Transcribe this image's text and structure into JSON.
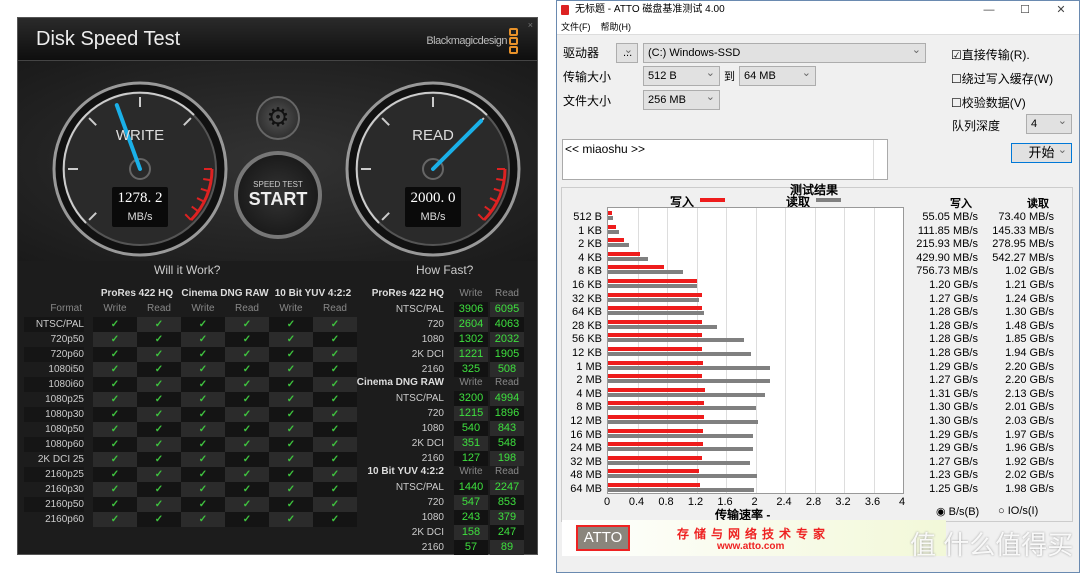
{
  "bm": {
    "title": "Disk Speed Test",
    "brand": "Blackmagicdesign",
    "close": "×",
    "write_label": "WRITE",
    "read_label": "READ",
    "write_value": "1278. 2",
    "read_value": "2000. 0",
    "unit": "MB/s",
    "write_mbps": 1278.2,
    "read_mbps": 2000.0,
    "needle_color": "#1ab0e8",
    "accent": "#e8922a",
    "start_small": "SPEED TEST",
    "start_big": "START",
    "will_title": "Will it Work?",
    "how_title": "How Fast?",
    "groups": [
      "ProRes 422 HQ",
      "Cinema DNG RAW",
      "10 Bit YUV 4:2:2"
    ],
    "format_label": "Format",
    "write": "Write",
    "read": "Read",
    "formats": [
      "NTSC/PAL",
      "720p50",
      "720p60",
      "1080i50",
      "1080i60",
      "1080p25",
      "1080p30",
      "1080p50",
      "1080p60",
      "2K DCI 25",
      "2160p25",
      "2160p30",
      "2160p50",
      "2160p60"
    ],
    "check": "✓",
    "fast": [
      {
        "name": "ProRes 422 HQ",
        "rows": [
          [
            "NTSC/PAL",
            "3906",
            "6095"
          ],
          [
            "720",
            "2604",
            "4063"
          ],
          [
            "1080",
            "1302",
            "2032"
          ],
          [
            "2K DCI",
            "1221",
            "1905"
          ],
          [
            "2160",
            "325",
            "508"
          ]
        ]
      },
      {
        "name": "Cinema DNG RAW",
        "rows": [
          [
            "NTSC/PAL",
            "3200",
            "4994"
          ],
          [
            "720",
            "1215",
            "1896"
          ],
          [
            "1080",
            "540",
            "843"
          ],
          [
            "2K DCI",
            "351",
            "548"
          ],
          [
            "2160",
            "127",
            "198"
          ]
        ]
      },
      {
        "name": "10 Bit YUV 4:2:2",
        "rows": [
          [
            "NTSC/PAL",
            "1440",
            "2247"
          ],
          [
            "720",
            "547",
            "853"
          ],
          [
            "1080",
            "243",
            "379"
          ],
          [
            "2K DCI",
            "158",
            "247"
          ],
          [
            "2160",
            "57",
            "89"
          ]
        ]
      }
    ]
  },
  "atto": {
    "title": "无标题 - ATTO 磁盘基准测试 4.00",
    "min": "—",
    "max": "☐",
    "close": "✕",
    "menu": [
      "文件(F)",
      "帮助(H)"
    ],
    "drive_label": "驱动器",
    "browse": "...",
    "drive": "(C:) Windows-SSD",
    "transfer_label": "传输大小",
    "transfer_from": "512 B",
    "to": "到",
    "transfer_to": "64 MB",
    "file_label": "文件大小",
    "file_size": "256 MB",
    "direct": "直接传输(R).",
    "bypass": "绕过写入缓存(W)",
    "verify": "校验数据(V)",
    "direct_checked": true,
    "bypass_checked": false,
    "verify_checked": false,
    "queue_label": "队列深度",
    "queue": "4",
    "start": "开始",
    "description": "<< miaoshu >>",
    "results_title": "测试结果",
    "write_legend": "写入",
    "read_legend": "读取",
    "xaxis_label": "传输速率 -",
    "col_write": "写入",
    "col_read": "读取",
    "unit_bytes": "B/s(B)",
    "unit_io": "IO/s(I)",
    "unit_selected": "B/s(B)",
    "banner_slogan": "存储与网络技术专家",
    "banner_url": "www.atto.com",
    "logo": "ATTO"
  },
  "chart_data": {
    "type": "bar",
    "orientation": "horizontal",
    "xlabel": "传输速率 -",
    "xlim": [
      0,
      4
    ],
    "xticks": [
      "0",
      "0.4",
      "0.8",
      "1.2",
      "1.6",
      "2",
      "2.4",
      "2.8",
      "3.2",
      "3.6",
      "4"
    ],
    "grid": true,
    "legend": "top",
    "categories": [
      "512 B",
      "1 KB",
      "2 KB",
      "4 KB",
      "8 KB",
      "16 KB",
      "32 KB",
      "64 KB",
      "28 KB",
      "56 KB",
      "12 KB",
      "1 MB",
      "2 MB",
      "4 MB",
      "8 MB",
      "12 MB",
      "16 MB",
      "24 MB",
      "32 MB",
      "48 MB",
      "64 MB"
    ],
    "series": [
      {
        "name": "写入",
        "color": "#ee1c1c",
        "values": [
          0.05505,
          0.11185,
          0.21593,
          0.4299,
          0.75673,
          1.2,
          1.27,
          1.28,
          1.28,
          1.28,
          1.28,
          1.29,
          1.27,
          1.31,
          1.3,
          1.3,
          1.29,
          1.29,
          1.27,
          1.23,
          1.25
        ],
        "labels": [
          "55.05 MB/s",
          "111.85 MB/s",
          "215.93 MB/s",
          "429.90 MB/s",
          "756.73 MB/s",
          "1.20 GB/s",
          "1.27 GB/s",
          "1.28 GB/s",
          "1.28 GB/s",
          "1.28 GB/s",
          "1.28 GB/s",
          "1.29 GB/s",
          "1.27 GB/s",
          "1.31 GB/s",
          "1.30 GB/s",
          "1.30 GB/s",
          "1.29 GB/s",
          "1.29 GB/s",
          "1.27 GB/s",
          "1.23 GB/s",
          "1.25 GB/s"
        ]
      },
      {
        "name": "读取",
        "color": "#808080",
        "values": [
          0.0734,
          0.14533,
          0.27895,
          0.54227,
          1.02,
          1.21,
          1.24,
          1.3,
          1.48,
          1.85,
          1.94,
          2.2,
          2.2,
          2.13,
          2.01,
          2.03,
          1.97,
          1.96,
          1.92,
          2.02,
          1.98
        ],
        "labels": [
          "73.40 MB/s",
          "145.33 MB/s",
          "278.95 MB/s",
          "542.27 MB/s",
          "1.02 GB/s",
          "1.21 GB/s",
          "1.24 GB/s",
          "1.30 GB/s",
          "1.48 GB/s",
          "1.85 GB/s",
          "1.94 GB/s",
          "2.20 GB/s",
          "2.20 GB/s",
          "2.13 GB/s",
          "2.01 GB/s",
          "2.03 GB/s",
          "1.97 GB/s",
          "1.96 GB/s",
          "1.92 GB/s",
          "2.02 GB/s",
          "1.98 GB/s"
        ]
      }
    ]
  },
  "watermark": "值 什么值得买"
}
